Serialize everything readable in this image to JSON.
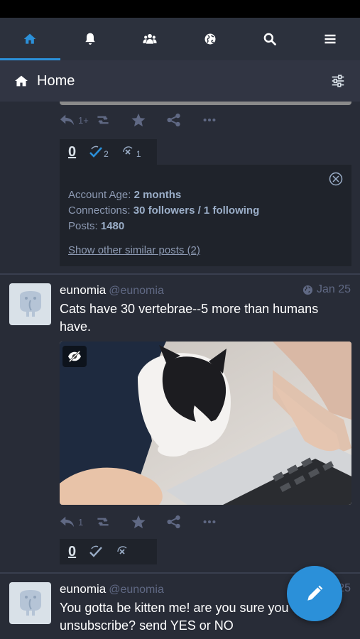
{
  "nav": {
    "tabs": [
      {
        "icon": "home-icon",
        "active": true
      },
      {
        "icon": "bell-icon",
        "active": false
      },
      {
        "icon": "users-icon",
        "active": false
      },
      {
        "icon": "globe-icon",
        "active": false
      },
      {
        "icon": "search-icon",
        "active": false
      },
      {
        "icon": "menu-icon",
        "active": false
      }
    ]
  },
  "header": {
    "title": "Home",
    "icon": "home-icon",
    "settings_icon": "sliders-icon"
  },
  "post1": {
    "reply_count": "1+",
    "votes": {
      "zero": "0",
      "approve": "2",
      "reject": "1"
    },
    "info": {
      "account_age_label": "Account Age:",
      "account_age_value": "2 months",
      "connections_label": "Connections:",
      "connections_value": "30 followers / 1 following",
      "posts_label": "Posts:",
      "posts_value": "1480",
      "similar_link": "Show other similar posts (2)"
    }
  },
  "post2": {
    "display_name": "eunomia",
    "handle": "@eunomia",
    "date": "Jan 25",
    "text": "Cats have 30 vertebrae--5 more than humans have.",
    "reply_count": "1",
    "votes": {
      "zero": "0"
    }
  },
  "post3": {
    "display_name": "eunomia",
    "handle": "@eunomia",
    "date": "Jan 25",
    "text": "You gotta be kitten me! are you sure you want to unsubscribe? send YES or NO"
  },
  "colors": {
    "accent": "#2b90d9",
    "background": "#282c37",
    "muted": "#606984"
  }
}
